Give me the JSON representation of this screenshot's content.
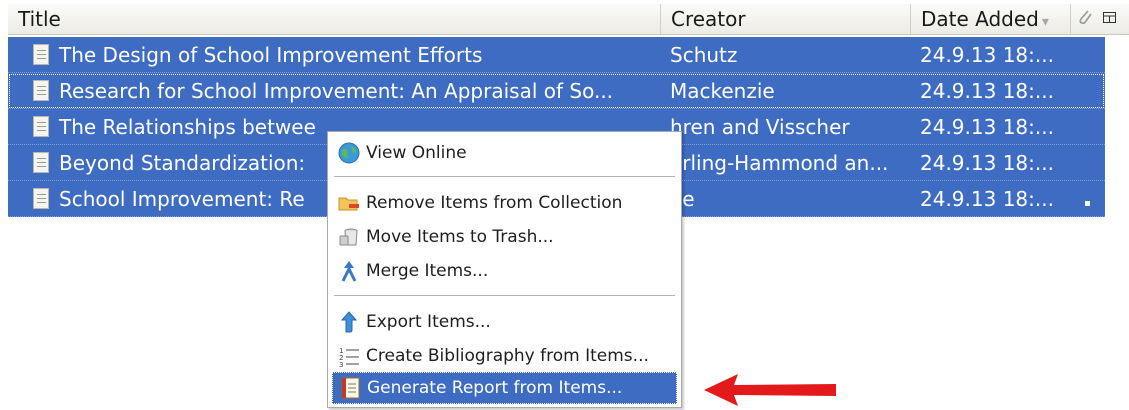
{
  "columns": {
    "title": "Title",
    "creator": "Creator",
    "date_added": "Date Added",
    "sort_indicator": "▾",
    "attachment_icon": "paperclip-icon",
    "column_picker_icon": "column-picker-icon"
  },
  "rows": [
    {
      "title": "The Design of School Improvement Efforts",
      "creator": "Schutz",
      "date": "24.9.13 18:..."
    },
    {
      "title": "Research for School Improvement: An Appraisal of So...",
      "creator": "Mackenzie",
      "date": "24.9.13 18:..."
    },
    {
      "title": "The Relationships betwee",
      "creator": "hren and Visscher",
      "date": "24.9.13 18:..."
    },
    {
      "title": "Beyond Standardization:",
      "creator": "arling-Hammond an...",
      "date": "24.9.13 18:..."
    },
    {
      "title": "School Improvement: Re",
      "creator": "oe",
      "date": "24.9.13 18:..."
    }
  ],
  "context_menu": {
    "items": [
      {
        "label": "View Online",
        "icon": "globe-icon"
      },
      {
        "label": "Remove Items from Collection",
        "icon": "folder-remove-icon"
      },
      {
        "label": "Move Items to Trash...",
        "icon": "trash-icon"
      },
      {
        "label": "Merge Items...",
        "icon": "merge-icon"
      },
      {
        "label": "Export Items...",
        "icon": "export-arrow-icon"
      },
      {
        "label": "Create Bibliography from Items...",
        "icon": "bibliography-list-icon"
      },
      {
        "label": "Generate Report from Items...",
        "icon": "report-icon"
      }
    ],
    "selected_index": 6
  },
  "annotation": {
    "icon": "red-arrow-icon",
    "color": "#e3191b"
  },
  "colors": {
    "selection": "#3d6cc2",
    "header": "#ecebe5"
  }
}
